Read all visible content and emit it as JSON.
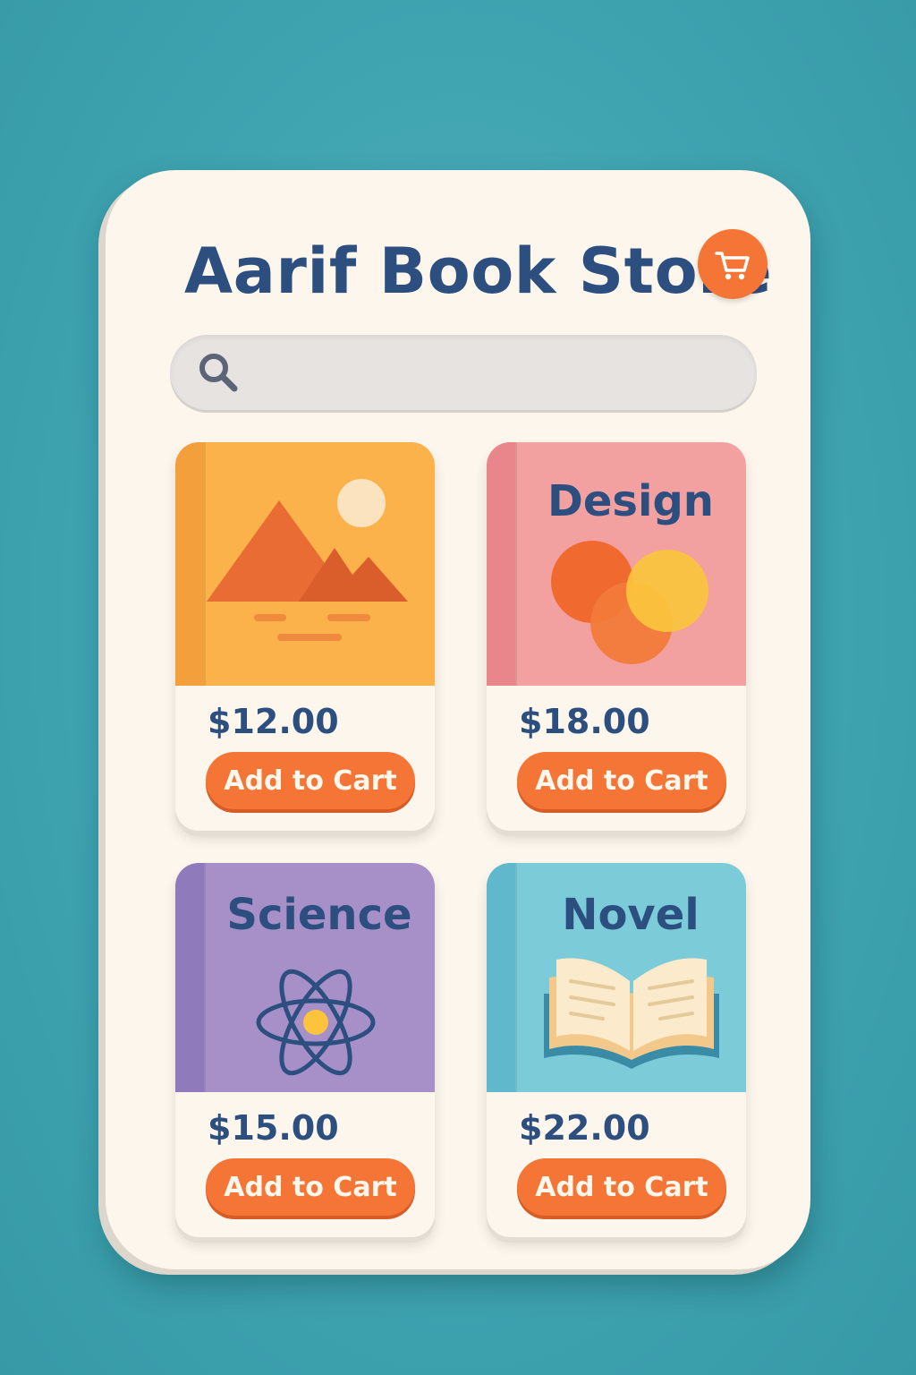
{
  "header": {
    "title": "Aarif Book Store",
    "cart_icon": "shopping-cart-icon"
  },
  "search": {
    "icon": "search-icon",
    "value": "",
    "placeholder": ""
  },
  "colors": {
    "background": "#45a8b4",
    "panel": "#fcf6ec",
    "title_text": "#2d4f80",
    "accent_orange": "#f47535",
    "search_bg": "#e6e3e0"
  },
  "products": [
    {
      "cover_title": "",
      "cover_icon": "landscape-image-icon",
      "cover_color": "#fbb24b",
      "price": "$12.00",
      "button_label": "Add to Cart"
    },
    {
      "cover_title": "Design",
      "cover_icon": "overlapping-circles-icon",
      "cover_color": "#f3a0a0",
      "price": "$18.00",
      "button_label": "Add to Cart"
    },
    {
      "cover_title": "Science",
      "cover_icon": "atom-icon",
      "cover_color": "#a790c8",
      "price": "$15.00",
      "button_label": "Add to Cart"
    },
    {
      "cover_title": "Novel",
      "cover_icon": "open-book-icon",
      "cover_color": "#7ccbd9",
      "price": "$22.00",
      "button_label": "Add to Cart"
    }
  ]
}
